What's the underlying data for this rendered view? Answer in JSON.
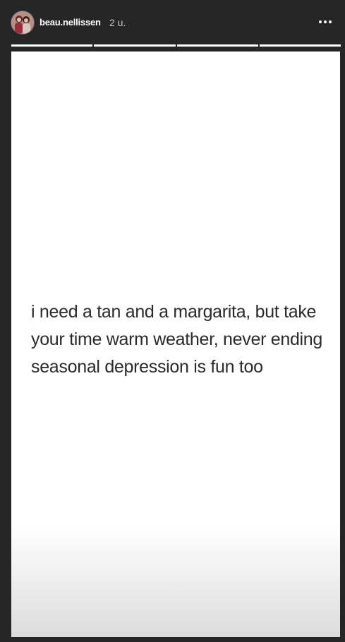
{
  "header": {
    "username": "beau.nellissen",
    "timestamp": "2 u."
  },
  "progress": {
    "segments": [
      1,
      1,
      1,
      1
    ]
  },
  "story": {
    "text": "i need a tan and a margarita, but take your time warm weather, never ending seasonal depression is fun too"
  },
  "icons": {
    "avatar": "profile-photo",
    "more": "more-options-icon"
  },
  "colors": {
    "background": "#262626",
    "story_background": "#ffffff",
    "text": "#2a2a2a"
  }
}
